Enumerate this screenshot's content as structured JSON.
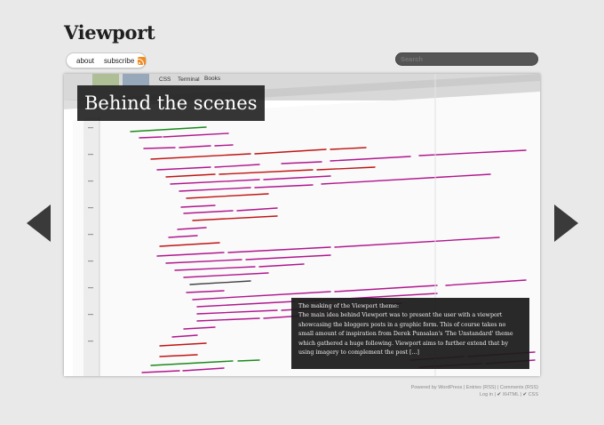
{
  "header": {
    "site_title": "Viewport"
  },
  "nav": {
    "about": "about",
    "subscribe": "subscribe",
    "rss_icon": "rss-icon"
  },
  "search": {
    "placeholder": "Search"
  },
  "slide": {
    "title": "Behind the scenes",
    "caption_title": "The making of the Viewport theme:",
    "caption_body": "The main idea behind Viewport was to present the user with a viewport showcasing the bloggers posts in a graphic form. This of course takes no small amount of inspiration from Derek Punsalan's 'The Unstandard' theme which gathered a huge following. Viewport aims to further extend that by using imagery to complement the post [...]",
    "screenshot_tabs": [
      "CSS",
      "Terminal",
      "Books"
    ]
  },
  "controls": {
    "prev_icon": "arrow-left-icon",
    "next_icon": "arrow-right-icon"
  },
  "footer": {
    "line1": "Powered by WordPress | Entries (RSS) | Comments (RSS)",
    "line2_prefix": "Log in |",
    "xhtml": "XHTML",
    "css": "CSS"
  },
  "colors": {
    "page_bg": "#e9e9e9",
    "accent_dark": "#3a3a3a",
    "rss": "#f28a1e"
  }
}
